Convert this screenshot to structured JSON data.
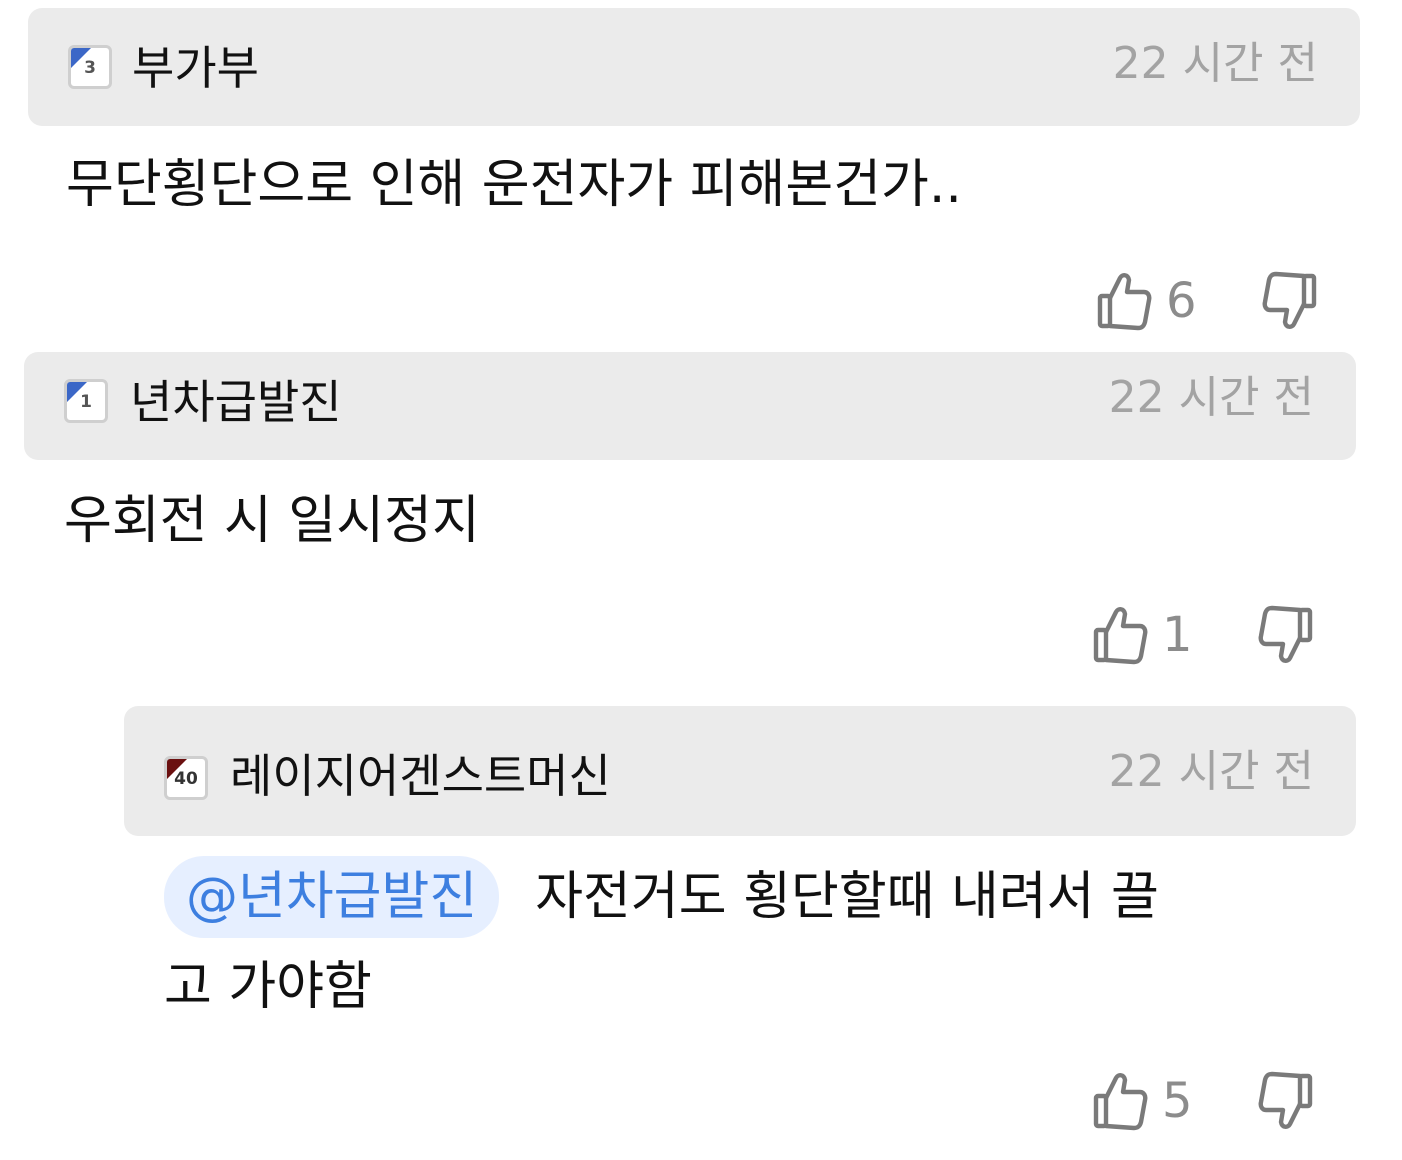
{
  "comments": [
    {
      "author": "부가부",
      "level": "3",
      "badge_color": "#3b67c7",
      "time": "22 시간 전",
      "text": "무단횡단으로 인해 운전자가 피해본건가..",
      "likes": "6"
    },
    {
      "author": "년차급발진",
      "level": "1",
      "badge_color": "#3b67c7",
      "time": "22 시간 전",
      "text": "우회전 시 일시정지",
      "likes": "1"
    }
  ],
  "reply": {
    "author": "레이지어겐스트머신",
    "level": "40",
    "badge_color": "#6b1010",
    "time": "22 시간 전",
    "mention": "@년차급발진",
    "text_line1": "자전거도 횡단할때 내려서 끌",
    "text_line2": "고 가야함",
    "likes": "5"
  },
  "colors": {
    "header_bg": "#ebebeb",
    "time_text": "#a3a3a3",
    "mention_bg": "#e6efff",
    "mention_text": "#3d7fe0",
    "vote_icon": "#7a7a7a"
  },
  "icons": {
    "like": "thumbs-up-icon",
    "dislike": "thumbs-down-icon"
  }
}
